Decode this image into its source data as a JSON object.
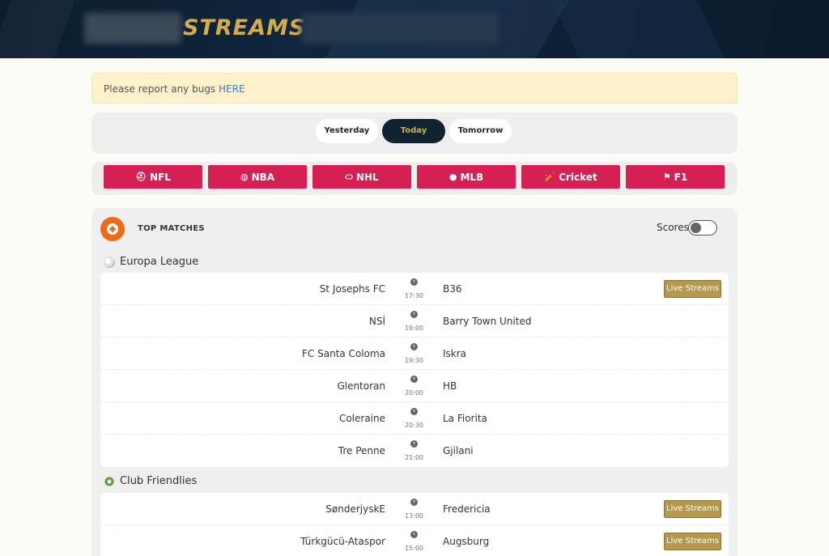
{
  "header": {
    "logo_text": "STREAMS"
  },
  "notice": {
    "text": "Please report any bugs ",
    "link": "HERE"
  },
  "days": {
    "yesterday": "Yesterday",
    "today": "Today",
    "tomorrow": "Tomorrow",
    "selected": "Today"
  },
  "sports": [
    {
      "label": "NFL",
      "icon": "football-helmet-icon"
    },
    {
      "label": "NBA",
      "icon": "basketball-icon"
    },
    {
      "label": "NHL",
      "icon": "hockey-icon"
    },
    {
      "label": "MLB",
      "icon": "baseball-icon"
    },
    {
      "label": "Cricket",
      "icon": "cricket-icon"
    },
    {
      "label": "F1",
      "icon": "racing-flag-icon"
    }
  ],
  "panel": {
    "title": "TOP MATCHES",
    "scores_label": "Scores",
    "scores_on": false
  },
  "leagues": [
    {
      "name": "Europa League",
      "matches": [
        {
          "home": "St Josephs FC",
          "time": "17:30",
          "away": "B36",
          "live": "Live Streams"
        },
        {
          "home": "NSÍ",
          "time": "19:00",
          "away": "Barry Town United",
          "live": ""
        },
        {
          "home": "FC Santa Coloma",
          "time": "19:30",
          "away": "Iskra",
          "live": ""
        },
        {
          "home": "Glentoran",
          "time": "20:00",
          "away": "HB",
          "live": ""
        },
        {
          "home": "Coleraine",
          "time": "20:30",
          "away": "La Fiorita",
          "live": ""
        },
        {
          "home": "Tre Penne",
          "time": "21:00",
          "away": "Gjilani",
          "live": ""
        }
      ]
    },
    {
      "name": "Club Friendlies",
      "matches": [
        {
          "home": "SønderjyskE",
          "time": "13:00",
          "away": "Fredericia",
          "live": "Live Streams"
        },
        {
          "home": "Türkgücü-Ataspor",
          "time": "15:00",
          "away": "Augsburg",
          "live": "Live Streams"
        }
      ]
    }
  ]
}
